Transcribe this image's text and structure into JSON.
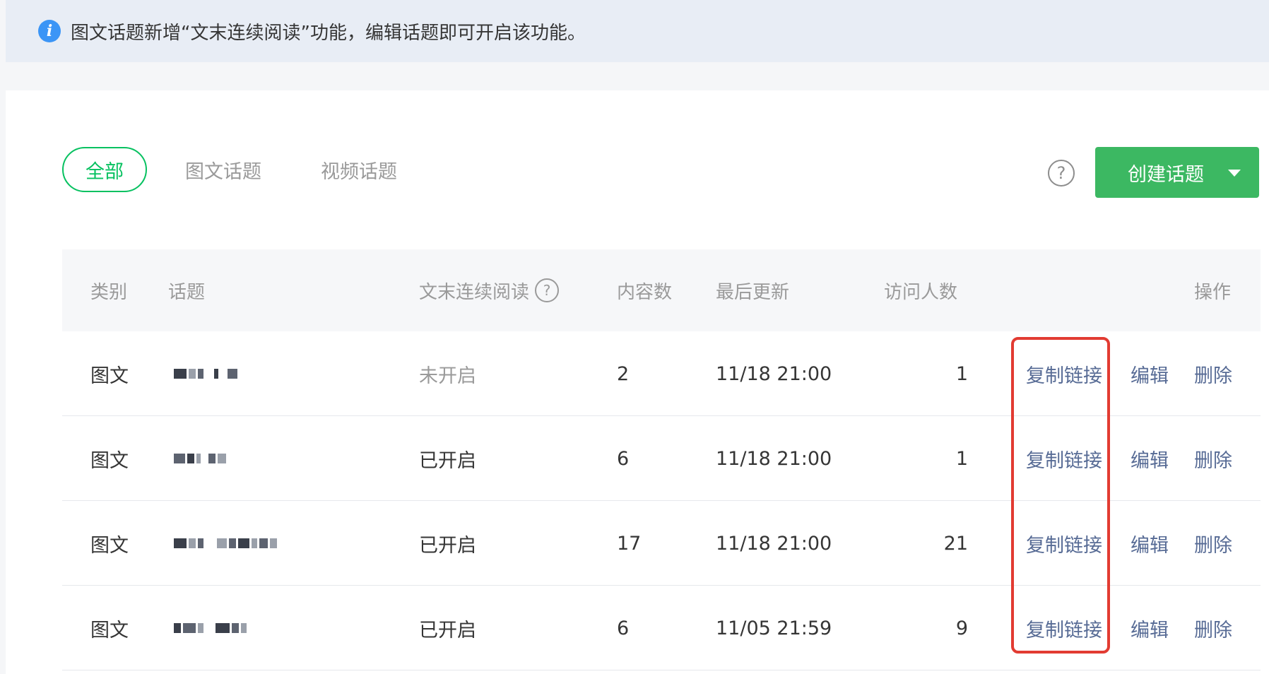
{
  "notice": {
    "icon": "info-icon",
    "text": "图文话题新增“文末连续阅读”功能，编辑话题即可开启该功能。"
  },
  "tabs": [
    {
      "label": "全部",
      "active": true
    },
    {
      "label": "图文话题",
      "active": false
    },
    {
      "label": "视频话题",
      "active": false
    }
  ],
  "help_icon_glyph": "?",
  "create_button": {
    "label": "创建话题"
  },
  "table": {
    "headers": {
      "category": "类别",
      "topic": "话题",
      "continuous_reading": "文末连续阅读",
      "content_count": "内容数",
      "last_update": "最后更新",
      "visitors": "访问人数",
      "actions": "操作"
    },
    "header_help_glyph": "?",
    "rows": [
      {
        "category": "图文",
        "continuous_reading": "未开启",
        "content_count": "2",
        "last_update": "11/18 21:00",
        "visitors": "1",
        "copy_link": "复制链接",
        "edit": "编辑",
        "delete": "删除"
      },
      {
        "category": "图文",
        "continuous_reading": "已开启",
        "content_count": "6",
        "last_update": "11/18 21:00",
        "visitors": "1",
        "copy_link": "复制链接",
        "edit": "编辑",
        "delete": "删除"
      },
      {
        "category": "图文",
        "continuous_reading": "已开启",
        "content_count": "17",
        "last_update": "11/18 21:00",
        "visitors": "21",
        "copy_link": "复制链接",
        "edit": "编辑",
        "delete": "删除"
      },
      {
        "category": "图文",
        "continuous_reading": "已开启",
        "content_count": "6",
        "last_update": "11/05 21:59",
        "visitors": "9",
        "copy_link": "复制链接",
        "edit": "编辑",
        "delete": "删除"
      }
    ]
  },
  "colors": {
    "accent_green": "#07c160",
    "button_green": "#3cb862",
    "link_blue": "#576b95",
    "highlight_red": "#e23b32",
    "info_blue": "#3b95f6"
  }
}
